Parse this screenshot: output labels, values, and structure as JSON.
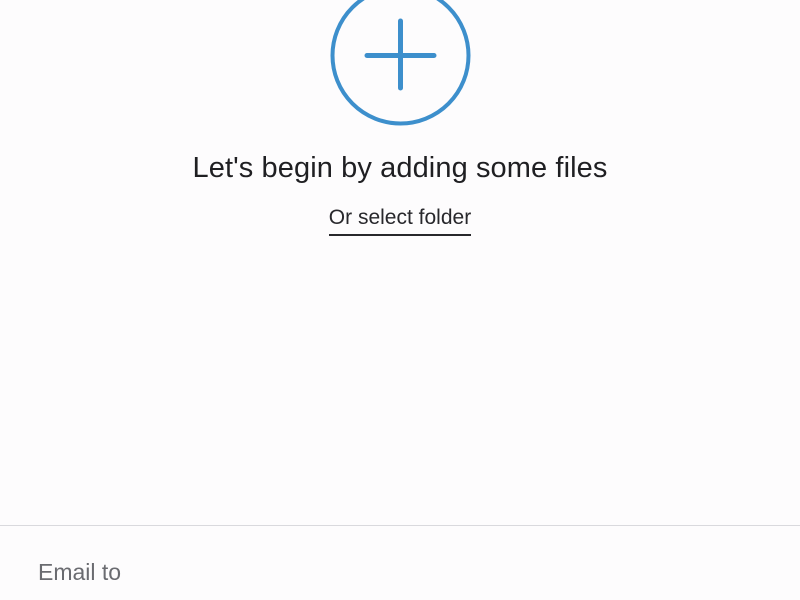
{
  "upload": {
    "add_icon": "plus-circle-icon",
    "headline": "Let's begin by adding some files",
    "select_folder_label": "Or select folder"
  },
  "form": {
    "email_placeholder": "Email to",
    "email_value": ""
  },
  "colors": {
    "accent": "#3d8fcc",
    "text": "#1f1f22",
    "placeholder": "#6a6b70",
    "divider": "#d9d9dd",
    "background": "#fdfcfd"
  }
}
